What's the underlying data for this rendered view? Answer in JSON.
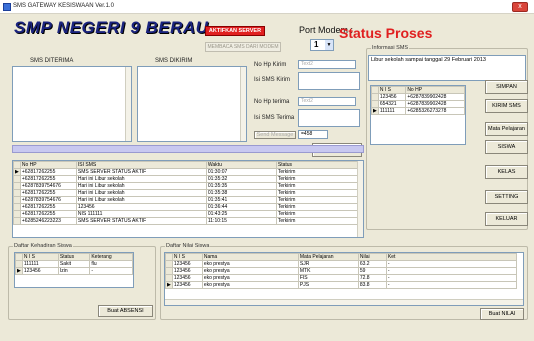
{
  "window": {
    "title": "SMS GATEWAY KESISWAAN  Ver.1.0",
    "close": "x"
  },
  "header": {
    "title": "SMP NEGERI 9 BERAU",
    "activate_btn": "AKTIFKAN SERVER",
    "read_btn": "MEMBACA SMS DARI MODEM",
    "port_label": "Port Modem :",
    "port_value": "1",
    "status": "Status Proses"
  },
  "left": {
    "received_label": "SMS DITERIMA",
    "sent_label": "SMS DIKIRIM"
  },
  "form": {
    "hp_kirim_label": "No Hp Kirim",
    "hp_kirim_placeholder": "Text2",
    "isi_kirim_label": "Isi SMS Kirim",
    "hp_terima_label": "No Hp terima",
    "hp_terima_placeholder": "Text2",
    "isi_terima_label": "Isi SMS Terima",
    "send_btn": "Send Message",
    "counter": "=458",
    "clear_btn": "BERSIHKAN"
  },
  "info": {
    "group_label": "Informasi SMS",
    "message": "Libur sekolah sampai tanggal 29 Februari 2013"
  },
  "contacts": {
    "headers": [
      "N I S",
      "No HP"
    ],
    "rows": [
      [
        "123456",
        "+6287839902428"
      ],
      [
        "654321",
        "+6287839902428"
      ],
      [
        "111111",
        "+6285326273278"
      ]
    ]
  },
  "side_buttons": [
    "SIMPAN",
    "KIRIM SMS",
    "Mata Pelajaran",
    "SISWA",
    "KELAS",
    "SETTING",
    "KELUAR"
  ],
  "log": {
    "headers": [
      "No HP",
      "ISI SMS",
      "Waktu",
      "Status"
    ],
    "rows": [
      [
        "+62817262255",
        "SMS SERVER STATUS AKTIF",
        "01:30:07",
        "Terkirim"
      ],
      [
        "+62817262255",
        "Hari ini Libur sekolah",
        "01:35:32",
        "Terkirim"
      ],
      [
        "+6287839754676",
        "Hari ini Libur sekolah",
        "01:35:35",
        "Terkirim"
      ],
      [
        "+62817262255",
        "Hari ini Libur sekolah",
        "01:35:38",
        "Terkirim"
      ],
      [
        "+6287839754676",
        "Hari ini Libur sekolah",
        "01:35:41",
        "Terkirim"
      ],
      [
        "+62817262255",
        "123456",
        "01:36:44",
        "Terkirim"
      ],
      [
        "+62817262255",
        "NIS 111111",
        "01:43:25",
        "Terkirim"
      ],
      [
        "+6285246223223",
        "SMS SERVER STATUS AKTIF",
        "11:10:15",
        "Terkirim"
      ]
    ]
  },
  "absen": {
    "group_label": "Daftar Kehadiran Siswa",
    "headers": [
      "N I S",
      "Status",
      "Keterang"
    ],
    "rows": [
      [
        "111111",
        "Sakit",
        "flu"
      ],
      [
        "123456",
        "Izin",
        "-"
      ]
    ],
    "button": "Buat ABSENSI"
  },
  "nilai": {
    "group_label": "Daftar Nilai Siswa",
    "headers": [
      "N I S",
      "Nama",
      "Mata Pelajaran",
      "Nilai",
      "Ket"
    ],
    "rows": [
      [
        "123456",
        "eko prestya",
        "SJR",
        "63.2",
        "-"
      ],
      [
        "123456",
        "eko prestya",
        "MTK",
        "59",
        "-"
      ],
      [
        "123456",
        "eko prestya",
        "FIS",
        "72.8",
        "-"
      ],
      [
        "123456",
        "eko prestya",
        "PJS",
        "83.8",
        "-"
      ]
    ],
    "button": "Buat NILAI"
  }
}
